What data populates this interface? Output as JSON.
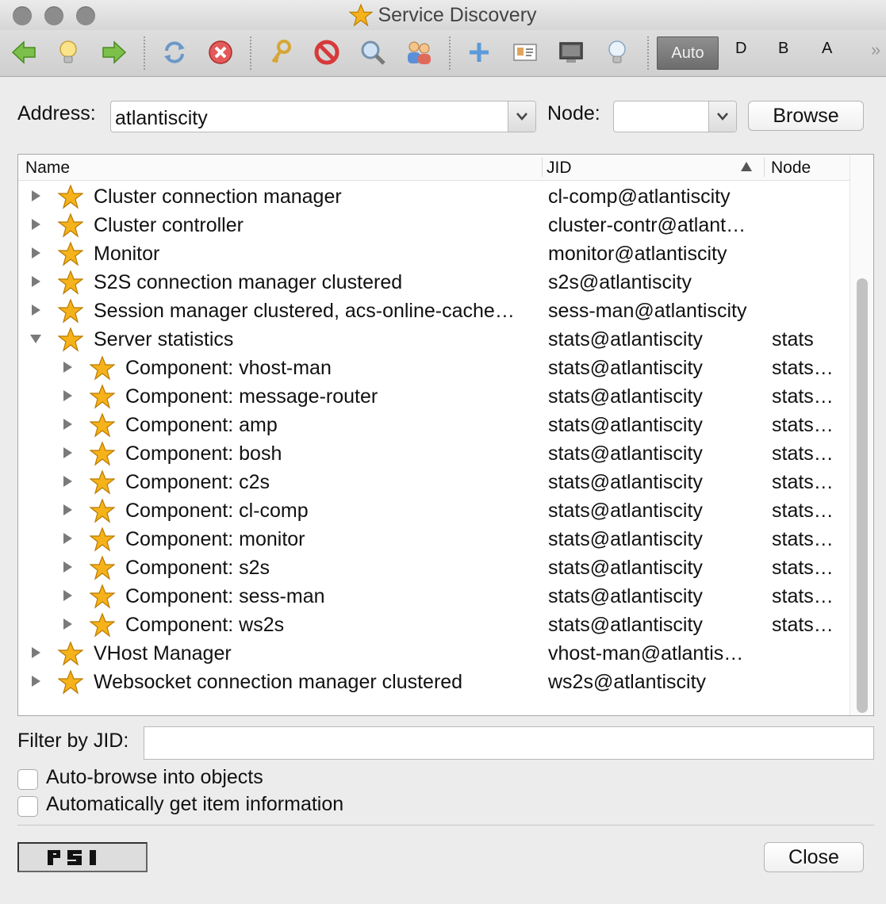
{
  "window": {
    "title": "Service Discovery"
  },
  "toolbar": {
    "buttons": [
      {
        "name": "back-arrow-icon"
      },
      {
        "name": "lightbulb-icon"
      },
      {
        "name": "forward-arrow-icon"
      },
      {
        "name": "refresh-icon"
      },
      {
        "name": "stop-icon"
      },
      {
        "name": "key-icon"
      },
      {
        "name": "block-icon"
      },
      {
        "name": "magnifier-icon"
      },
      {
        "name": "users-icon"
      },
      {
        "name": "add-icon"
      },
      {
        "name": "vcard-icon"
      },
      {
        "name": "monitor-icon"
      },
      {
        "name": "info-bulb-icon"
      }
    ],
    "auto_label": "Auto",
    "d_label": "D",
    "b_label": "B",
    "a_label": "A"
  },
  "address": {
    "label": "Address:",
    "value": "atlantiscity"
  },
  "node": {
    "label": "Node:",
    "value": ""
  },
  "browse_label": "Browse",
  "tree": {
    "columns": {
      "name": "Name",
      "jid": "JID",
      "node": "Node"
    },
    "sort": {
      "column": "JID",
      "direction": "ascending"
    },
    "rows": [
      {
        "level": 0,
        "expanded": false,
        "name": "Cluster connection manager",
        "jid": "cl-comp@atlantiscity",
        "node": ""
      },
      {
        "level": 0,
        "expanded": false,
        "name": "Cluster controller",
        "jid": "cluster-contr@atlant…",
        "node": ""
      },
      {
        "level": 0,
        "expanded": false,
        "name": "Monitor",
        "jid": "monitor@atlantiscity",
        "node": ""
      },
      {
        "level": 0,
        "expanded": false,
        "name": "S2S connection manager clustered",
        "jid": "s2s@atlantiscity",
        "node": ""
      },
      {
        "level": 0,
        "expanded": false,
        "name": "Session manager clustered, acs-online-cache…",
        "jid": "sess-man@atlantiscity",
        "node": ""
      },
      {
        "level": 0,
        "expanded": true,
        "name": "Server statistics",
        "jid": "stats@atlantiscity",
        "node": "stats"
      },
      {
        "level": 1,
        "expanded": false,
        "name": "Component: vhost-man",
        "jid": "stats@atlantiscity",
        "node": "stats…"
      },
      {
        "level": 1,
        "expanded": false,
        "name": "Component: message-router",
        "jid": "stats@atlantiscity",
        "node": "stats…"
      },
      {
        "level": 1,
        "expanded": false,
        "name": "Component: amp",
        "jid": "stats@atlantiscity",
        "node": "stats…"
      },
      {
        "level": 1,
        "expanded": false,
        "name": "Component: bosh",
        "jid": "stats@atlantiscity",
        "node": "stats…"
      },
      {
        "level": 1,
        "expanded": false,
        "name": "Component: c2s",
        "jid": "stats@atlantiscity",
        "node": "stats…"
      },
      {
        "level": 1,
        "expanded": false,
        "name": "Component: cl-comp",
        "jid": "stats@atlantiscity",
        "node": "stats…"
      },
      {
        "level": 1,
        "expanded": false,
        "name": "Component: monitor",
        "jid": "stats@atlantiscity",
        "node": "stats…"
      },
      {
        "level": 1,
        "expanded": false,
        "name": "Component: s2s",
        "jid": "stats@atlantiscity",
        "node": "stats…"
      },
      {
        "level": 1,
        "expanded": false,
        "name": "Component: sess-man",
        "jid": "stats@atlantiscity",
        "node": "stats…"
      },
      {
        "level": 1,
        "expanded": false,
        "name": "Component: ws2s",
        "jid": "stats@atlantiscity",
        "node": "stats…"
      },
      {
        "level": 0,
        "expanded": false,
        "name": "VHost Manager",
        "jid": "vhost-man@atlantis…",
        "node": ""
      },
      {
        "level": 0,
        "expanded": false,
        "name": "Websocket connection manager clustered",
        "jid": "ws2s@atlantiscity",
        "node": ""
      }
    ]
  },
  "filter": {
    "label": "Filter by JID:",
    "value": ""
  },
  "options": {
    "auto_browse_label": "Auto-browse into objects",
    "auto_browse_checked": false,
    "auto_info_label": "Automatically get item information",
    "auto_info_checked": false
  },
  "logo_text": "PSI",
  "close_label": "Close",
  "colors": {
    "star": "#f5b21a",
    "auto_button": "#7a7a7a",
    "background": "#ececec"
  }
}
